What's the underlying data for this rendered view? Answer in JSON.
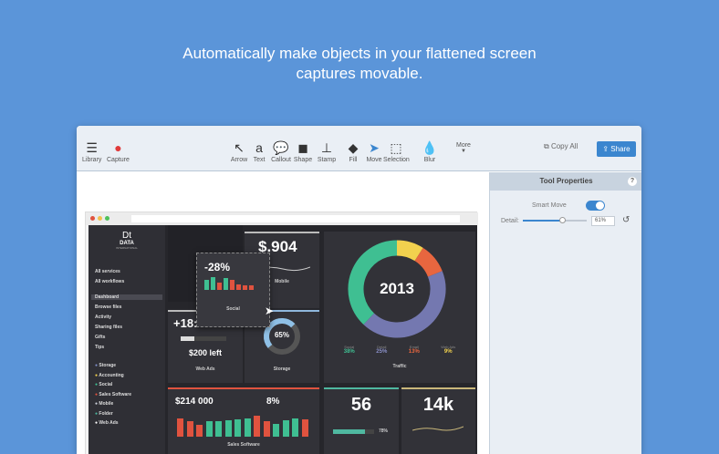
{
  "headline": [
    "Automatically make objects in your flattened screen",
    "captures movable."
  ],
  "toolbar": {
    "left": [
      {
        "label": "Library",
        "icon": "library-icon"
      },
      {
        "label": "Capture",
        "icon": "record-icon"
      }
    ],
    "tools": [
      {
        "label": "Arrow",
        "glyph": "↖"
      },
      {
        "label": "Text",
        "glyph": "a"
      },
      {
        "label": "Callout",
        "glyph": "💬"
      },
      {
        "label": "Shape",
        "glyph": "◼"
      },
      {
        "label": "Stamp",
        "glyph": "⊥"
      },
      {
        "label": "Fill",
        "glyph": "◆"
      },
      {
        "label": "Move",
        "glyph": "➤"
      },
      {
        "label": "Selection",
        "glyph": "⬚"
      },
      {
        "label": "Blur",
        "glyph": "💧"
      }
    ],
    "more": "More",
    "copy_all": "Copy All",
    "share": "Share"
  },
  "panel": {
    "title": "Tool Properties",
    "help": "?",
    "smart_move": "Smart Move",
    "smart_move_on": true,
    "detail_label": "Detail:",
    "detail_value": "61%",
    "detail_fraction": 0.61
  },
  "dashboard": {
    "logo": [
      "Dt",
      "DATA",
      "INTERNATIONAL"
    ],
    "nav": [
      "All services",
      "All workflows",
      "Dashboard",
      "Browse files",
      "Activity",
      "Sharing files",
      "Gifts",
      "Tips"
    ],
    "services": [
      {
        "label": "Storage",
        "color": "#7f8fc9"
      },
      {
        "label": "Accounting",
        "color": "#f2d14e"
      },
      {
        "label": "Social",
        "color": "#3fbf92"
      },
      {
        "label": "Sales Software",
        "color": "#e0533f"
      },
      {
        "label": "Mobile",
        "color": "#cfd3dc"
      },
      {
        "label": "Folder",
        "color": "#4fb8a0"
      },
      {
        "label": "Web Ads",
        "color": "#ffffff"
      }
    ],
    "mobile": {
      "value": "$.904",
      "label": "Mobile"
    },
    "social": {
      "value": "-28%",
      "label": "Social",
      "bars": [
        0.7,
        0.85,
        0.5,
        0.8,
        0.7,
        0.4,
        0.3,
        0.3
      ],
      "colors": [
        "#3fbf92",
        "#3fbf92",
        "#e0533f",
        "#3fbf92",
        "#e0533f",
        "#e0533f",
        "#e0533f",
        "#e0533f"
      ]
    },
    "webads": {
      "value": "+18:",
      "left": "$200 left",
      "label": "Web Ads"
    },
    "storage": {
      "value": "65%",
      "label": "Storage",
      "fraction": 0.65
    },
    "traffic": {
      "center": "2013",
      "label": "Traffic",
      "slices": [
        {
          "pct": 38,
          "color": "#3fbf92"
        },
        {
          "pct": 43,
          "color": "#7478b0"
        },
        {
          "pct": 10,
          "color": "#e8663f"
        },
        {
          "pct": 9,
          "color": "#f2d14e"
        }
      ],
      "legend": [
        {
          "label": "Social",
          "value": "38%",
          "color": "#3fbf92"
        },
        {
          "label": "Detail",
          "value": "25%",
          "color": "#8a8fc8"
        },
        {
          "label": "Email",
          "value": "13%",
          "color": "#e8663f"
        },
        {
          "label": "Web Ads",
          "value": "9%",
          "color": "#f2d14e"
        }
      ]
    },
    "sales": {
      "value": "$214 000",
      "pct": "8%",
      "label": "Sales Software",
      "bars": [
        0.85,
        0.7,
        0.55,
        0.7,
        0.7,
        0.75,
        0.8,
        0.85,
        0.95,
        0.7,
        0.6,
        0.75,
        0.85,
        0.8
      ],
      "colors": [
        "#e0533f",
        "#e0533f",
        "#e0533f",
        "#3fbf92",
        "#3fbf92",
        "#3fbf92",
        "#3fbf92",
        "#3fbf92",
        "#e0533f",
        "#e0533f",
        "#3fbf92",
        "#3fbf92",
        "#3fbf92",
        "#e0533f"
      ]
    },
    "folder": {
      "value": "56",
      "pct": "78%",
      "fraction": 0.78
    },
    "accounting": {
      "value": "14k"
    }
  }
}
